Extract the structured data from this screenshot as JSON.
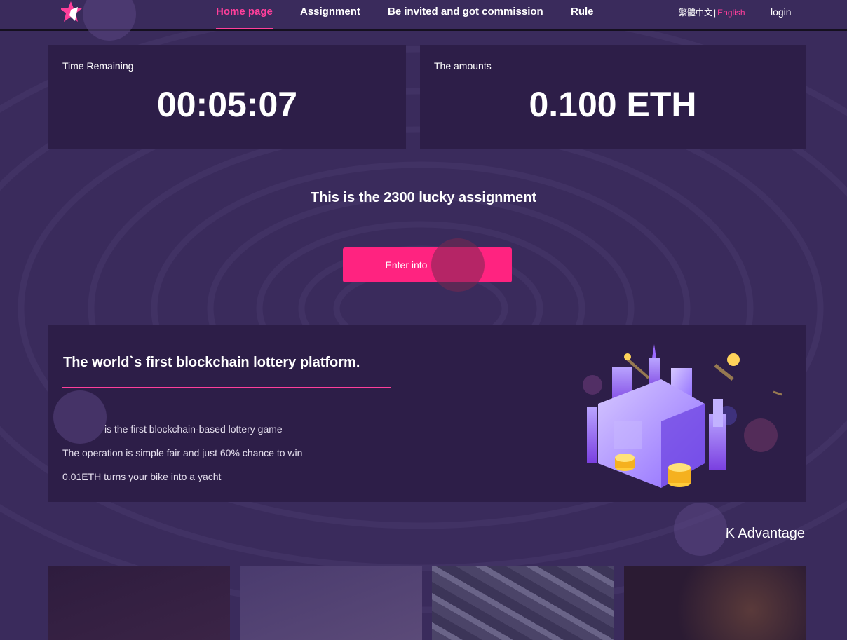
{
  "header": {
    "nav": [
      "Home page",
      "Assignment",
      "Be invited and got commission",
      "Rule"
    ],
    "active_index": 0,
    "lang_zh": "繁體中文",
    "lang_sep": "|",
    "lang_en": "English",
    "login": "login"
  },
  "stats": {
    "time_label": "Time Remaining",
    "time_value": "00:05:07",
    "amount_label": "The amounts",
    "amount_value": "0.100 ETH"
  },
  "lucky_text": "This is the 2300 lucky assignment",
  "enter_button": "Enter into",
  "platform": {
    "title": "The world`s first blockchain lottery platform.",
    "lines": [
      "is the first blockchain-based lottery game",
      "The operation is simple fair and just 60% chance to win",
      "0.01ETH turns your bike into a yacht"
    ]
  },
  "advantage_title": "K Advantage",
  "colors": {
    "background": "#3a2b5c",
    "panel": "#2d1e48",
    "accent": "#ff3f9b",
    "button": "#ff2380"
  }
}
